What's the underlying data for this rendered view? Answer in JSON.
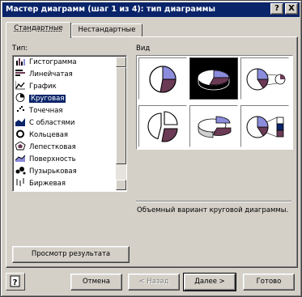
{
  "window": {
    "title": "Мастер диаграмм (шаг 1 из 4): тип диаграммы"
  },
  "titlebar_buttons": {
    "help": "?",
    "close": "X"
  },
  "tabs": [
    {
      "label": "Стандартные",
      "active": true
    },
    {
      "label": "Нестандартные",
      "active": false
    }
  ],
  "type_label": "Тип:",
  "view_label": "Вид",
  "chart_types": [
    {
      "label": "Гистограмма",
      "icon": "column-chart-icon"
    },
    {
      "label": "Линейчатая",
      "icon": "bar-chart-icon"
    },
    {
      "label": "График",
      "icon": "line-chart-icon"
    },
    {
      "label": "Круговая",
      "icon": "pie-chart-icon",
      "selected": true
    },
    {
      "label": "Точечная",
      "icon": "scatter-chart-icon"
    },
    {
      "label": "С областями",
      "icon": "area-chart-icon"
    },
    {
      "label": "Кольцевая",
      "icon": "doughnut-chart-icon"
    },
    {
      "label": "Лепестковая",
      "icon": "radar-chart-icon"
    },
    {
      "label": "Поверхность",
      "icon": "surface-chart-icon"
    },
    {
      "label": "Пузырьковая",
      "icon": "bubble-chart-icon"
    },
    {
      "label": "Биржевая",
      "icon": "stock-chart-icon"
    }
  ],
  "subtypes": [
    {
      "name": "pie",
      "selected": false
    },
    {
      "name": "pie-3d",
      "selected": true
    },
    {
      "name": "pie-of-pie",
      "selected": false
    },
    {
      "name": "exploded-pie",
      "selected": false
    },
    {
      "name": "exploded-pie-3d",
      "selected": false
    },
    {
      "name": "bar-of-pie",
      "selected": false
    }
  ],
  "description": "Объемный вариант круговой диаграммы.",
  "buttons": {
    "preview": "Просмотр результата",
    "cancel": "Отмена",
    "back": "< Назад",
    "next": "Далее >",
    "finish": "Готово"
  },
  "colors": {
    "titlebar": "#0a246a",
    "pie_blue": "#8c8cdc",
    "pie_maroon": "#6b3a55",
    "pie_white": "#ffffff"
  }
}
